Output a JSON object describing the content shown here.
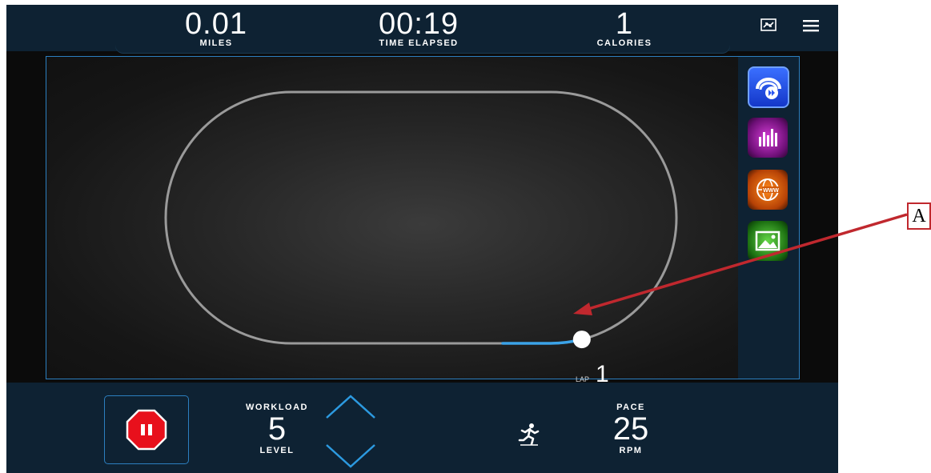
{
  "header": {
    "distance": {
      "value": "0.01",
      "label": "MILES"
    },
    "time": {
      "value": "00:19",
      "label": "TIME ELAPSED"
    },
    "calories": {
      "value": "1",
      "label": "CALORIES"
    },
    "icons": [
      "swap-display-icon",
      "hamburger-menu-icon"
    ]
  },
  "track": {
    "lap_label": "LAP",
    "lap_number": "1",
    "progress_fraction": 0.02
  },
  "side_apps": [
    {
      "name": "workout-programs-icon",
      "color": "#2a56f0"
    },
    {
      "name": "performance-stats-icon",
      "color": "#b323b8"
    },
    {
      "name": "web-browser-icon",
      "color": "#e0650e"
    },
    {
      "name": "scenery-icon",
      "color": "#3aa52a"
    }
  ],
  "controls": {
    "workload": {
      "caption": "WORKLOAD",
      "value": "5",
      "unit": "LEVEL"
    },
    "pace": {
      "caption": "PACE",
      "value": "25",
      "unit": "RPM"
    },
    "stop_icon": "stop-pause-icon",
    "activity_icon": "runner-icon"
  },
  "annotation": {
    "label": "A"
  },
  "colors": {
    "accent": "#2c7fc0",
    "bar": "#0e2233",
    "stop": "#e8101c",
    "progress": "#3ba3e8"
  }
}
